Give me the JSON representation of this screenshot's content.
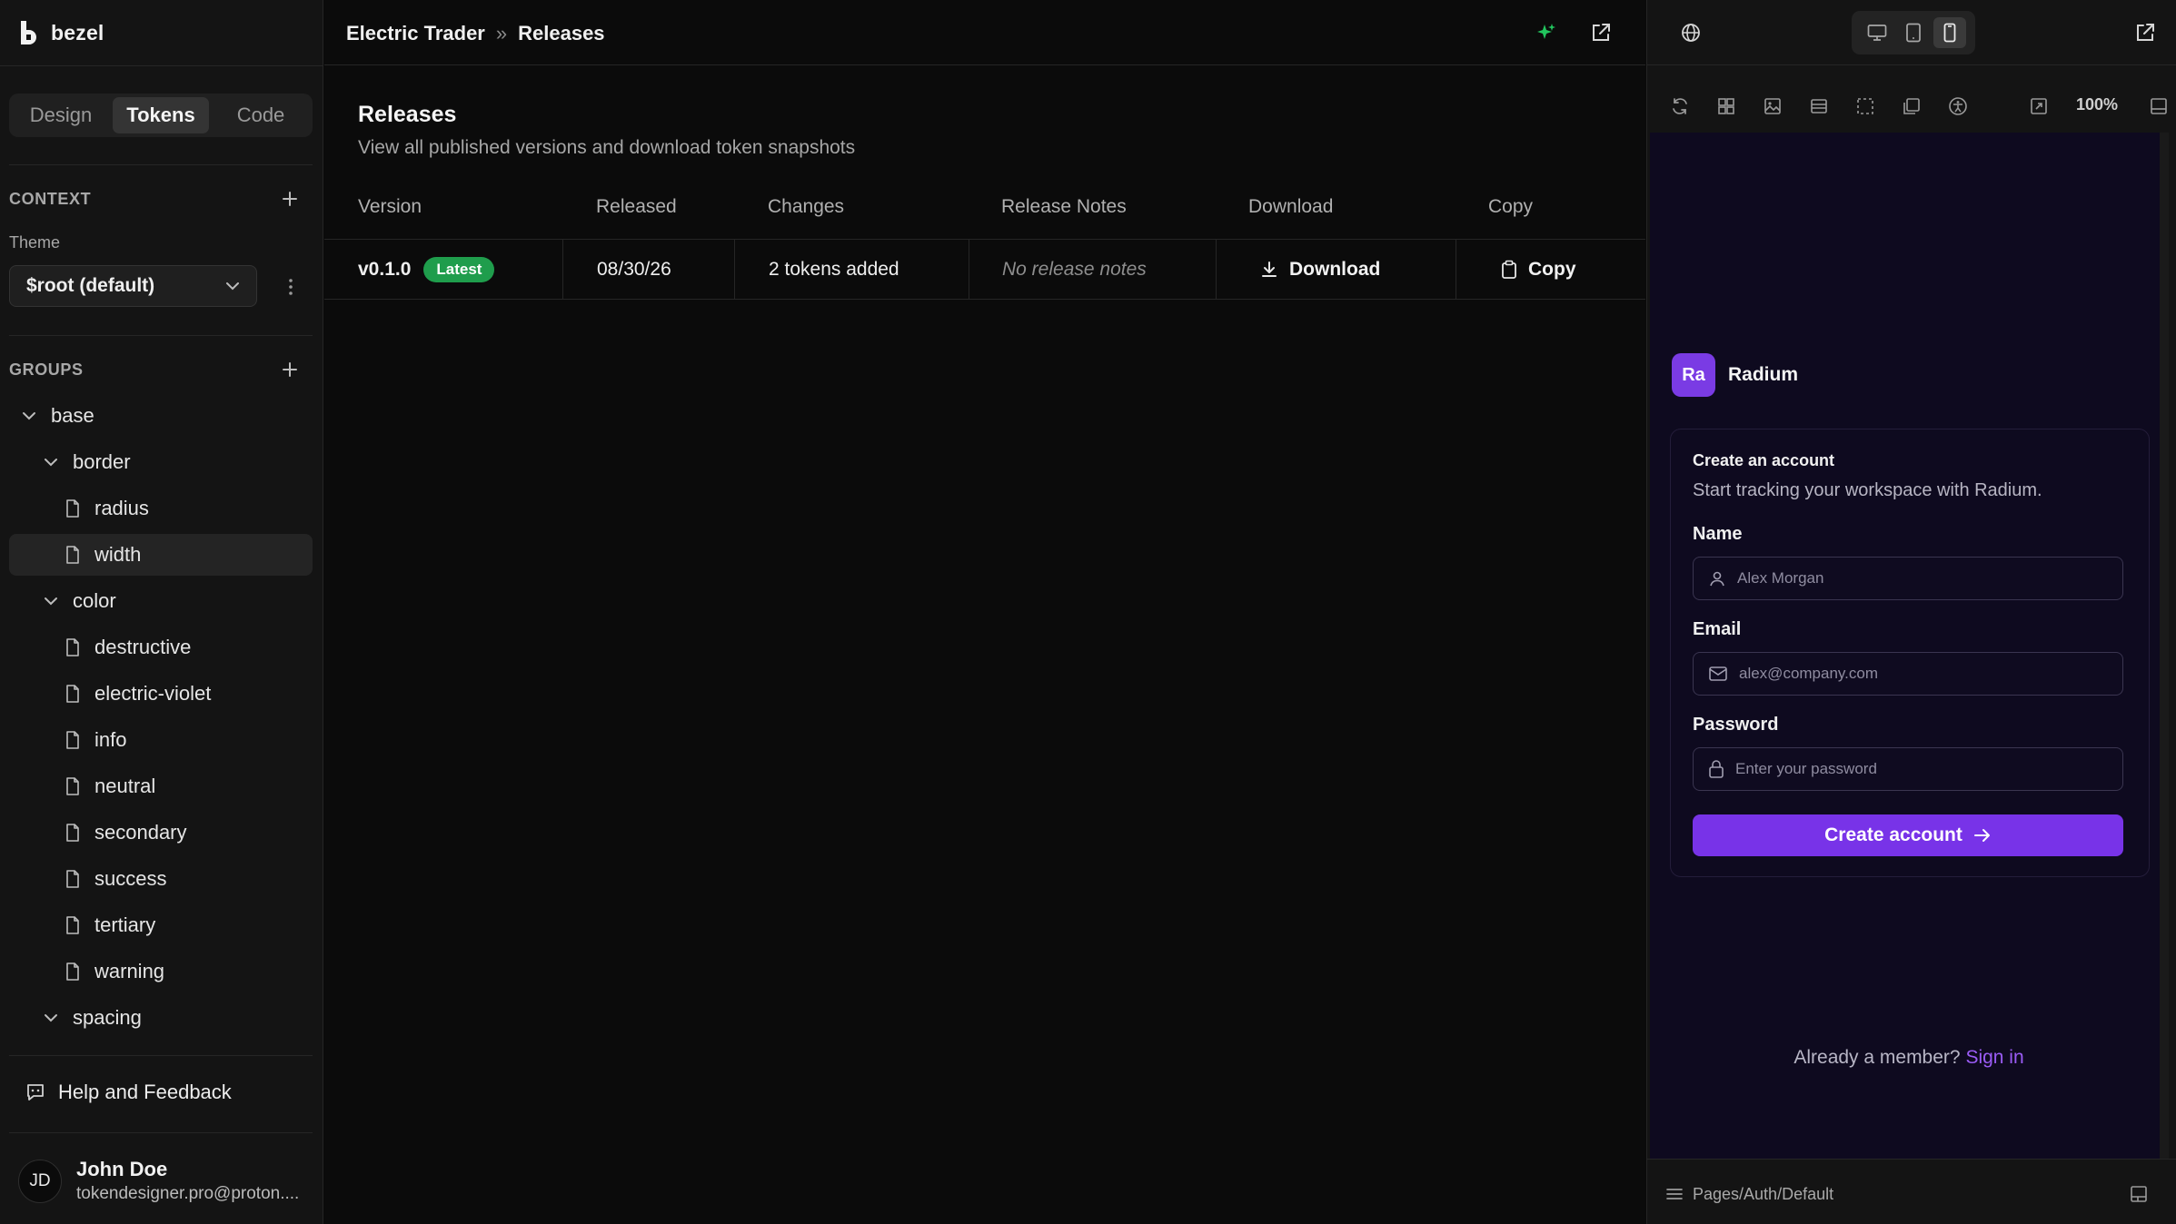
{
  "app": {
    "brand": "bezel"
  },
  "sidebar": {
    "tabs": [
      {
        "label": "Design",
        "active": false
      },
      {
        "label": "Tokens",
        "active": true
      },
      {
        "label": "Code",
        "active": false
      }
    ],
    "context_label": "CONTEXT",
    "theme_label": "Theme",
    "theme_value": "$root (default)",
    "groups_label": "GROUPS",
    "tree": {
      "base": "base",
      "border": "border",
      "radius": "radius",
      "width": "width",
      "color": "color",
      "destructive": "destructive",
      "electric_violet": "electric-violet",
      "info": "info",
      "neutral": "neutral",
      "secondary": "secondary",
      "success": "success",
      "tertiary": "tertiary",
      "warning": "warning",
      "spacing": "spacing"
    },
    "help_label": "Help and Feedback",
    "user": {
      "initials": "JD",
      "name": "John Doe",
      "email": "tokendesigner.pro@proton...."
    }
  },
  "header": {
    "breadcrumb": [
      "Electric Trader",
      "Releases"
    ],
    "separator": "»"
  },
  "releases": {
    "title": "Releases",
    "subtitle": "View all published versions and download token snapshots",
    "columns": {
      "version": "Version",
      "released": "Released",
      "changes": "Changes",
      "notes": "Release Notes",
      "download": "Download",
      "copy": "Copy"
    },
    "rows": [
      {
        "version": "v0.1.0",
        "badge": "Latest",
        "released": "08/30/26",
        "changes": "2 tokens added",
        "notes": "No release notes",
        "download": "Download",
        "copy": "Copy"
      }
    ]
  },
  "preview": {
    "zoom": "100%",
    "brand_initials": "Ra",
    "brand_name": "Radium",
    "card_title": "Create an account",
    "card_subtitle": "Start tracking your workspace with Radium.",
    "name_label": "Name",
    "name_placeholder": "Alex Morgan",
    "email_label": "Email",
    "email_placeholder": "alex@company.com",
    "password_label": "Password",
    "password_placeholder": "Enter your password",
    "submit_label": "Create account",
    "member_text": "Already a member?",
    "signin_label": "Sign in",
    "path": "Pages/Auth/Default"
  },
  "colors": {
    "accent": "#7833e8",
    "badge_green": "#1f9d4c",
    "link": "#9b5cf6",
    "sparkle": "#22c55e"
  }
}
